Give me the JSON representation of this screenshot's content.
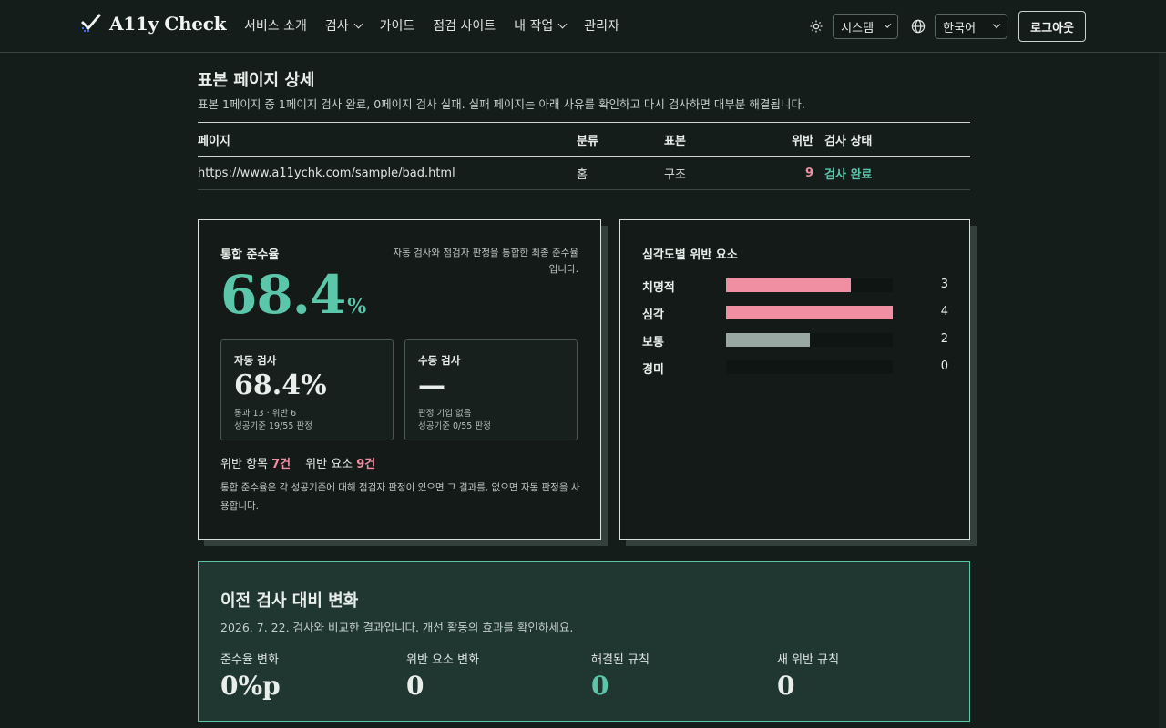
{
  "header": {
    "logo_text": "A11y Check",
    "nav": [
      {
        "label": "서비스 소개",
        "dropdown": false
      },
      {
        "label": "검사",
        "dropdown": true
      },
      {
        "label": "가이드",
        "dropdown": false
      },
      {
        "label": "점검 사이트",
        "dropdown": false
      },
      {
        "label": "내 작업",
        "dropdown": true
      },
      {
        "label": "관리자",
        "dropdown": false
      }
    ],
    "theme_select": "시스템",
    "language_select": "한국어",
    "logout_label": "로그아웃"
  },
  "sample": {
    "title": "표본 페이지 상세",
    "description": "표본 1페이지 중 1페이지 검사 완료, 0페이지 검사 실패. 실패 페이지는 아래 사유를 확인하고 다시 검사하면 대부분 해결됩니다.",
    "columns": [
      "페이지",
      "분류",
      "표본",
      "위반",
      "검사 상태"
    ],
    "rows": [
      {
        "page": "https://www.a11ychk.com/sample/bad.html",
        "category": "홈",
        "sample": "구조",
        "violations": "9",
        "status": "검사 완료"
      }
    ]
  },
  "compliance": {
    "title": "통합 준수율",
    "note": "자동 검사와 점검자 판정을 통합한 최종 준수율입니다.",
    "value": "68.4",
    "unit": "%",
    "auto": {
      "label": "자동 검사",
      "value": "68.4%",
      "line1": "통과 13 · 위반 6",
      "line2": "성공기준 19/55 판정"
    },
    "manual": {
      "label": "수동 검사",
      "value": "—",
      "line1": "판정 기입 없음",
      "line2": "성공기준 0/55 판정"
    },
    "violation_items_label": "위반 항목",
    "violation_items_value": "7건",
    "violation_elements_label": "위반 요소",
    "violation_elements_value": "9건",
    "footnote": "통합 준수율은 각 성공기준에 대해 점검자 판정이 있으면 그 결과를, 없으면 자동 판정을 사용합니다."
  },
  "severity": {
    "title": "심각도별 위반 요소",
    "max": 4,
    "items": [
      {
        "label": "치명적",
        "value": 3,
        "color": "#ef8fa1"
      },
      {
        "label": "심각",
        "value": 4,
        "color": "#ef8fa1"
      },
      {
        "label": "보통",
        "value": 2,
        "color": "#9aa8a3"
      },
      {
        "label": "경미",
        "value": 0,
        "color": "#9aa8a3"
      }
    ]
  },
  "change": {
    "title": "이전 검사 대비 변화",
    "description": "2026. 7. 22. 검사와 비교한 결과입니다. 개선 활동의 효과를 확인하세요.",
    "metrics": [
      {
        "label": "준수율 변화",
        "value": "0%p",
        "highlight": false
      },
      {
        "label": "위반 요소 변화",
        "value": "0",
        "highlight": false
      },
      {
        "label": "해결된 규칙",
        "value": "0",
        "highlight": true
      },
      {
        "label": "새 위반 규칙",
        "value": "0",
        "highlight": false
      }
    ]
  },
  "colors": {
    "accent": "#5cc6ab",
    "danger": "#ef8fa1",
    "background": "#151d1a"
  }
}
